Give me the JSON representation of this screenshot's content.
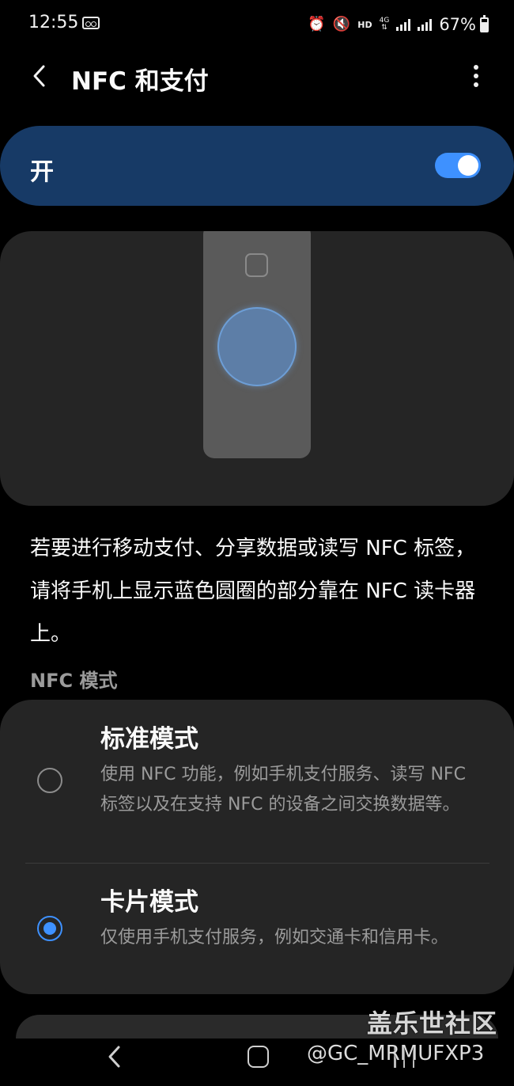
{
  "status_bar": {
    "time": "12:55",
    "network_label": "HD",
    "lte_label": "4G",
    "battery_percent": "67%"
  },
  "header": {
    "title": "NFC 和支付"
  },
  "master_switch": {
    "label": "开",
    "enabled": true
  },
  "description": "若要进行移动支付、分享数据或读写 NFC 标签，请将手机上显示蓝色圆圈的部分靠在 NFC 读卡器上。",
  "nfc_mode": {
    "section_label": "NFC 模式",
    "options": [
      {
        "title": "标准模式",
        "description": "使用 NFC 功能，例如手机支付服务、读写 NFC 标签以及在支持 NFC 的设备之间交换数据等。",
        "selected": false
      },
      {
        "title": "卡片模式",
        "description": "仅使用手机支付服务，例如交通卡和信用卡。",
        "selected": true
      }
    ]
  },
  "watermark": {
    "site": "盖乐世社区",
    "user": "@GC_MRMUFXP3"
  },
  "colors": {
    "accent": "#3e91ff",
    "switch_bar": "#173a66",
    "card": "#252525",
    "secondary_text": "#9b9b9b"
  }
}
